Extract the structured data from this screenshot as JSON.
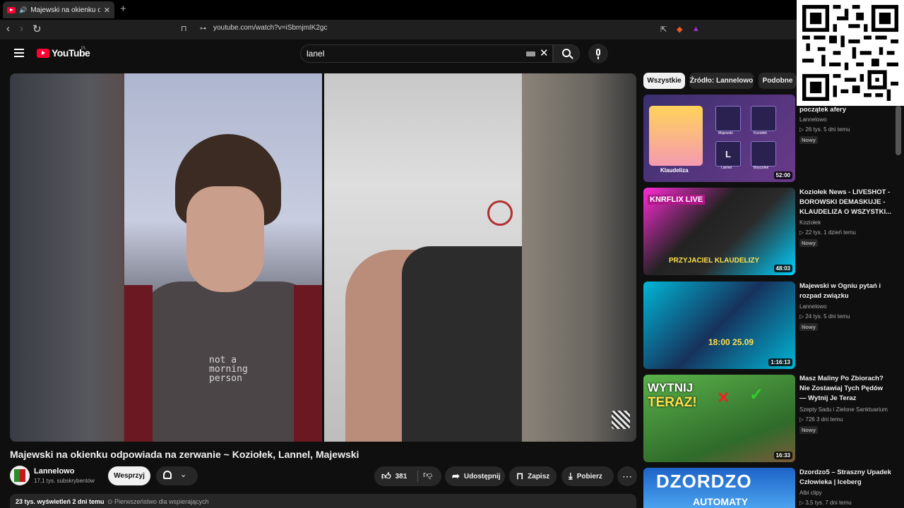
{
  "browser": {
    "tab_title": "Majewski na okienku odpowi",
    "tab_close": "✕",
    "new_tab": "+",
    "url": "youtube.com/watch?v=iSbmjmIK2gc",
    "back": "‹",
    "forward": "›",
    "reload": "↻"
  },
  "header": {
    "logo_text": "YouTube",
    "country": "PL",
    "search_value": "lanel",
    "search_clear": "✕"
  },
  "video": {
    "title": "Majewski na okienku odpowiada na zerwanie ~ Koziołek, Lannel, Majewski",
    "shirt_print": "not a morning person"
  },
  "channel": {
    "name": "Lannelowo",
    "subs": "17,1 tys. subskrybentów",
    "support_label": "Wesprzyj"
  },
  "actions": {
    "like_count": "381",
    "share": "Udostępnij",
    "save": "Zapisz",
    "download": "Pobierz",
    "more": "⋯"
  },
  "description": {
    "views_date": "23 tys. wyświetleń  2 dni temu",
    "priority": "⊙ Pierwszeństwo dla wspierających"
  },
  "chips": [
    "Wszystkie",
    "Źródło: Lannelowo",
    "Podobne"
  ],
  "recommendations": [
    {
      "title": "początek afery",
      "channel": "Lannelowo",
      "meta": "▷ 26 tys.  5 dni temu",
      "badge": "Nowy",
      "duration": "52:00",
      "thumb_text": "Klaudeliza"
    },
    {
      "title": "Koziołek News - LIVESHOT - BOROWSKI DEMASKUJE - KLAUDELIZA O WSZYSTKI...",
      "channel": "Koziołek",
      "meta": "▷ 22 tys.  1 dzień temu",
      "badge": "Nowy",
      "duration": "48:03",
      "thumb_text": "KNRFLIX LIVE",
      "thumb_text2": "PRZYJACIEL KLAUDELIZY"
    },
    {
      "title": "Majewski w Ogniu pytań i rozpad związku",
      "channel": "Lannelowo",
      "meta": "▷ 24 tys.  5 dni temu",
      "badge": "Nowy",
      "duration": "1:16:13",
      "thumb_text": "18:00 25.09"
    },
    {
      "title": "Masz Maliny Po Zbiorach? Nie Zostawiaj Tych Pędów — Wytnij Je Teraz",
      "channel": "Szepty Sadu i Zielone Sanktuarium",
      "meta": "▷ 726  3 dni temu",
      "badge": "Nowy",
      "duration": "16:33",
      "thumb_text": "WYTNIJ",
      "thumb_text2": "TERAZ!"
    },
    {
      "title": "Dzordzo5 – Straszny Upadek Człowieka | Iceberg",
      "channel": "Albi clipy",
      "meta": "▷ 3,5 tys.  7 dni temu",
      "thumb_text": "DZORDZO",
      "thumb_text2": "AUTOMATY"
    }
  ],
  "thumb1_labels": [
    "Majewski",
    "Koziołek",
    "Lannel",
    "Boyczilek"
  ],
  "colors": {
    "background": "#0f0f0f",
    "brand_red": "#ff0033",
    "chip_active": "#f1f1f1"
  }
}
